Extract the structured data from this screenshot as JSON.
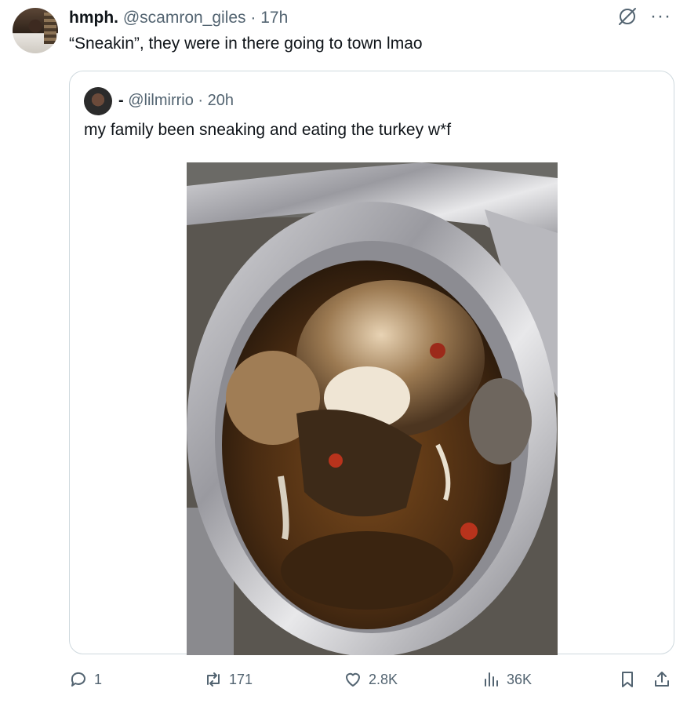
{
  "tweet": {
    "display_name": "hmph.",
    "handle": "@scamron_giles",
    "separator": "·",
    "time": "17h",
    "text": "“Sneakin”, they were in there going to town lmao"
  },
  "top_icons": {
    "grok_icon": "grok-icon",
    "more_label": "···"
  },
  "quote": {
    "display_name": "-",
    "handle": "@lilmirrio",
    "separator": "·",
    "time": "20h",
    "text": "my family been sneaking and eating the turkey w*f",
    "photo": "photo of a partially eaten roast turkey in a foil pan"
  },
  "actions": {
    "replies": "1",
    "reposts": "171",
    "likes": "2.8K",
    "views": "36K"
  },
  "colors": {
    "text_primary": "#0f1419",
    "text_secondary": "#536471",
    "border": "#cfd9de"
  }
}
